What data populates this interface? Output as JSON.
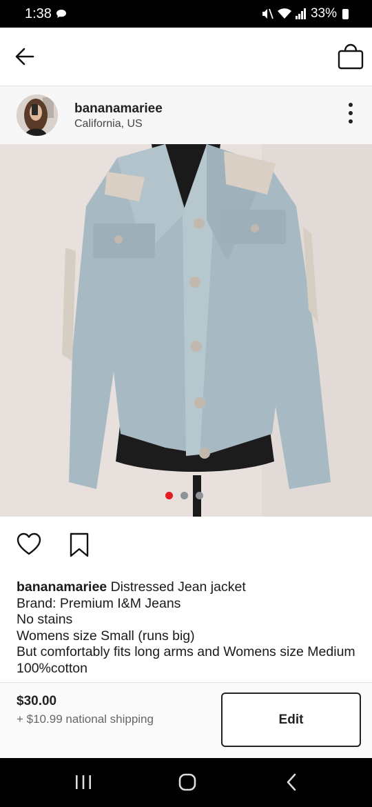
{
  "status_bar": {
    "time": "1:38",
    "battery": "33%",
    "icons": [
      "chat-bubble-icon",
      "mute-icon",
      "wifi-icon",
      "signal-icon",
      "battery-icon"
    ]
  },
  "app_bar": {
    "icons": [
      "back-arrow-icon",
      "shopping-bag-icon"
    ]
  },
  "seller": {
    "username": "bananamariee",
    "location": "California, US"
  },
  "listing": {
    "photo_count": 3,
    "active_photo": 1,
    "description": {
      "username": "bananamariee",
      "title": "Distressed Jean jacket",
      "lines": [
        "Brand: Premium I&M Jeans",
        "No stains",
        "Womens size Small (runs big)",
        "But comfortably fits long arms and Womens size Medium",
        "100%cotton"
      ]
    }
  },
  "actions": {
    "icons": [
      "heart-icon",
      "bookmark-icon"
    ]
  },
  "footer": {
    "price": "$30.00",
    "shipping": "+ $10.99 national shipping",
    "edit_label": "Edit"
  },
  "colors": {
    "accent_dot": "#e31b23",
    "inactive_dot": "#8d9396"
  }
}
